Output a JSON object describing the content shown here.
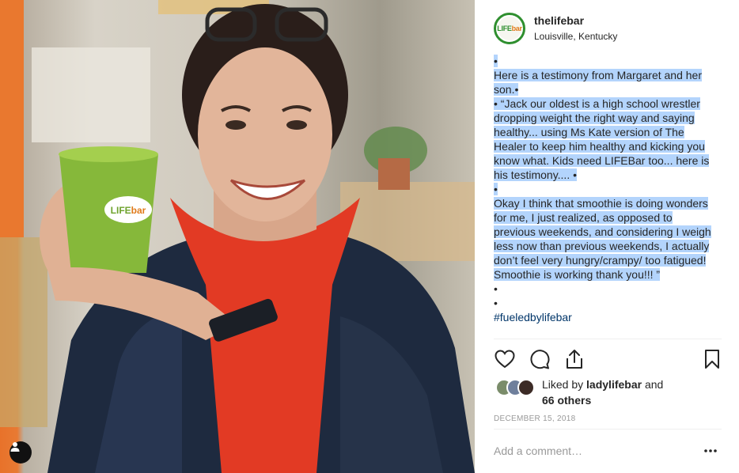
{
  "post": {
    "username": "thelifebar",
    "location": "Louisville, Kentucky",
    "avatar_logo": {
      "part1": "LIFE",
      "part2": "bar"
    },
    "cup_logo": {
      "part1": "LIFE",
      "part2": "bar"
    }
  },
  "caption": {
    "lines": [
      "•",
      "Here is a testimony from Margaret and her",
      "son.•",
      "• “Jack our oldest is a high school wrestler",
      "dropping weight the right way and saying",
      "healthy... using Ms Kate version of The",
      "Healer to keep him healthy and kicking you",
      "know what. Kids need LIFEBar too... here is",
      "his testimony.... •",
      "•",
      "Okay I think that smoothie is doing wonders",
      "for me, I just realized, as opposed to",
      "previous weekends, and considering I weigh",
      "less now than previous weekends, I actually",
      "don’t feel very hungry/crampy/ too fatigued!",
      "Smoothie is working thank you!!! ”",
      "•",
      "•"
    ],
    "hashtag": "#fueledbylifebar"
  },
  "actions": {
    "like_icon": "heart-icon",
    "comment_icon": "comment-bubble-icon",
    "share_icon": "share-icon",
    "save_icon": "bookmark-icon"
  },
  "likes": {
    "prefix": "Liked by",
    "user": "ladylifebar",
    "conjunction": "and",
    "others": "66 others"
  },
  "date": "DECEMBER 15, 2018",
  "comment": {
    "placeholder": "Add a comment…",
    "more_icon": "more-options-icon"
  },
  "colors": {
    "selection_highlight": "#b3d4fc",
    "hashtag": "#003569",
    "brand_green": "#2f8f2f"
  }
}
